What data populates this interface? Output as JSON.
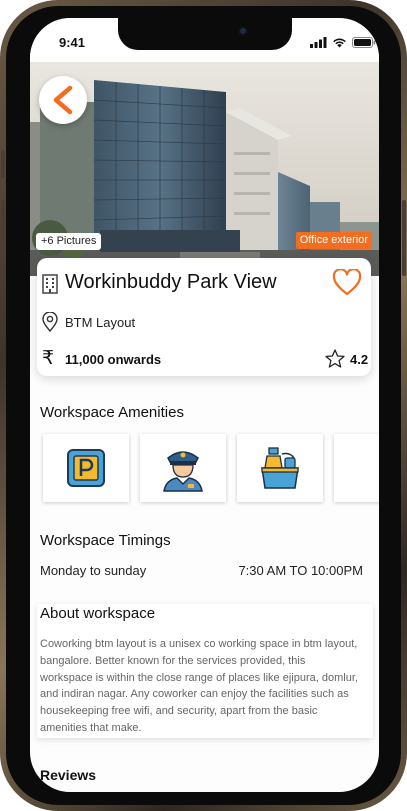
{
  "status_bar": {
    "time": "9:41"
  },
  "hero": {
    "pictures_count": "+6 Pictures",
    "photo_label": "Office exterior"
  },
  "workspace": {
    "name": "Workinbuddy Park View",
    "location": "BTM Layout",
    "currency_symbol": "₹",
    "price": "11,000 onwards",
    "rating": "4.2",
    "accent_color": "#f36d21"
  },
  "amenities": {
    "heading": "Workspace Amenities",
    "items": [
      {
        "icon": "parking-icon"
      },
      {
        "icon": "security-guard-icon"
      },
      {
        "icon": "housekeeping-icon"
      },
      {
        "icon": "amenity-icon"
      }
    ]
  },
  "timings": {
    "heading": "Workspace Timings",
    "days": "Monday to sunday",
    "hours": "7:30 AM TO 10:00PM"
  },
  "about": {
    "heading": "About workspace",
    "body": "Coworking btm layout is a unisex co working space in btm layout, bangalore. Better known for the services provided, this workspace is within the close range of places like ejipura, domlur, and indiran nagar. Any coworker can enjoy the facilities such as housekeeping free wifi, and security, apart from the basic amenities that make."
  },
  "reviews": {
    "heading": "Reviews"
  }
}
